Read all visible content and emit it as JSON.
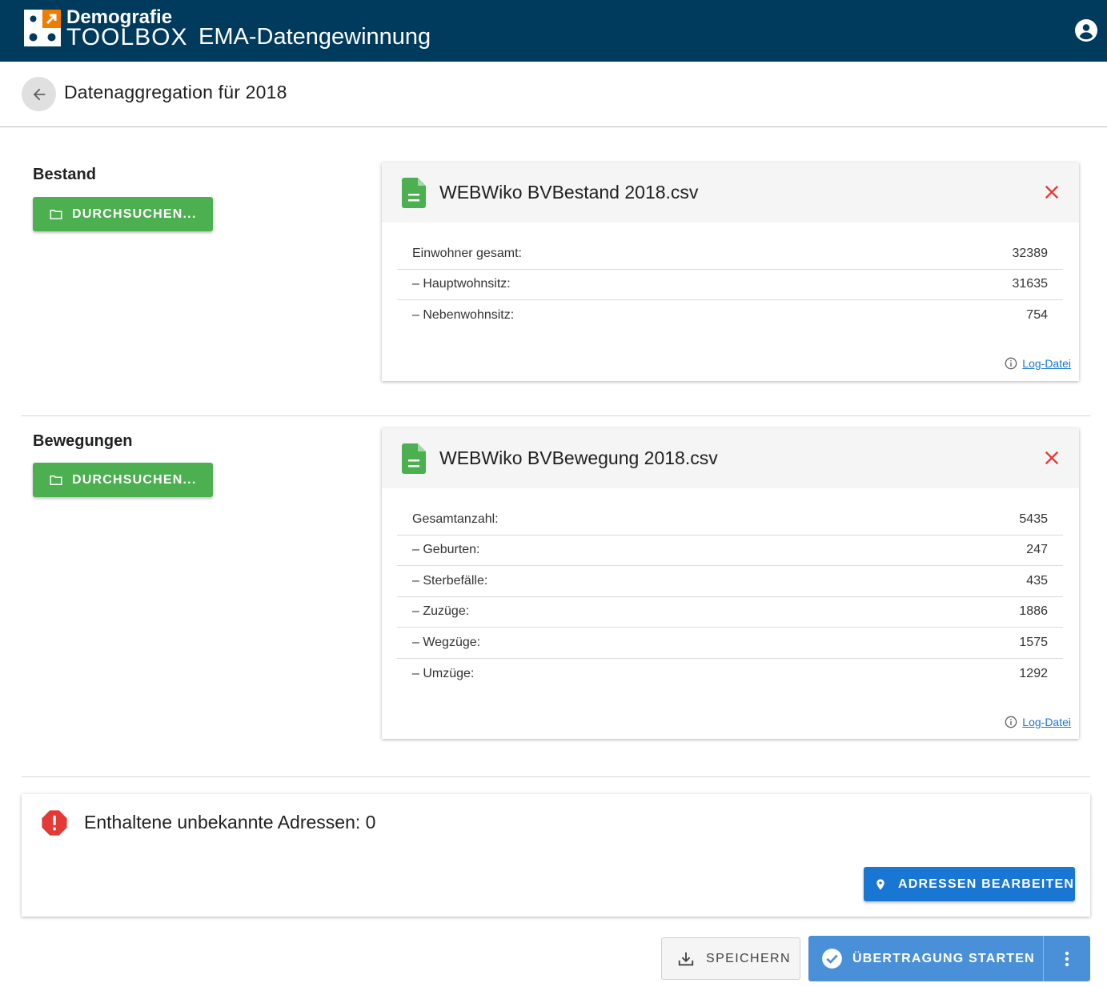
{
  "header": {
    "logo_line1": "Demografie",
    "logo_line2": "TOOLBOX",
    "app_title": "EMA-Datengewinnung",
    "account_icon": "account-circle-icon"
  },
  "subheader": {
    "back_icon": "arrow-left-icon",
    "title": "Datenaggregation für 2018"
  },
  "sections": {
    "bestand": {
      "label": "Bestand",
      "browse_label": "DURCHSUCHEN...",
      "file": {
        "name": "WEBWiko BVBestand 2018.csv",
        "rows": [
          {
            "label": "Einwohner gesamt:",
            "value": "32389"
          },
          {
            "label": "– Hauptwohnsitz:",
            "value": "31635"
          },
          {
            "label": "– Nebenwohnsitz:",
            "value": "754"
          }
        ],
        "log_label": "Log-Datei"
      }
    },
    "bewegungen": {
      "label": "Bewegungen",
      "browse_label": "DURCHSUCHEN...",
      "file": {
        "name": "WEBWiko BVBewegung 2018.csv",
        "rows": [
          {
            "label": "Gesamtanzahl:",
            "value": "5435"
          },
          {
            "label": "– Geburten:",
            "value": "247"
          },
          {
            "label": "– Sterbefälle:",
            "value": "435"
          },
          {
            "label": "– Zuzüge:",
            "value": "1886"
          },
          {
            "label": "– Wegzüge:",
            "value": "1575"
          },
          {
            "label": "– Umzüge:",
            "value": "1292"
          }
        ],
        "log_label": "Log-Datei"
      }
    }
  },
  "unknown_addresses": {
    "text": "Enthaltene unbekannte Adressen: 0",
    "edit_label": "ADRESSEN BEARBEITEN"
  },
  "actions": {
    "save_label": "SPEICHERN",
    "start_label": "ÜBERTRAGUNG STARTEN"
  },
  "colors": {
    "appbar": "#003a5d",
    "logo_orange": "#f07d00",
    "green": "#4caf50",
    "blue": "#1976d2",
    "start_blue": "#4a90d9",
    "red": "#e53935"
  }
}
